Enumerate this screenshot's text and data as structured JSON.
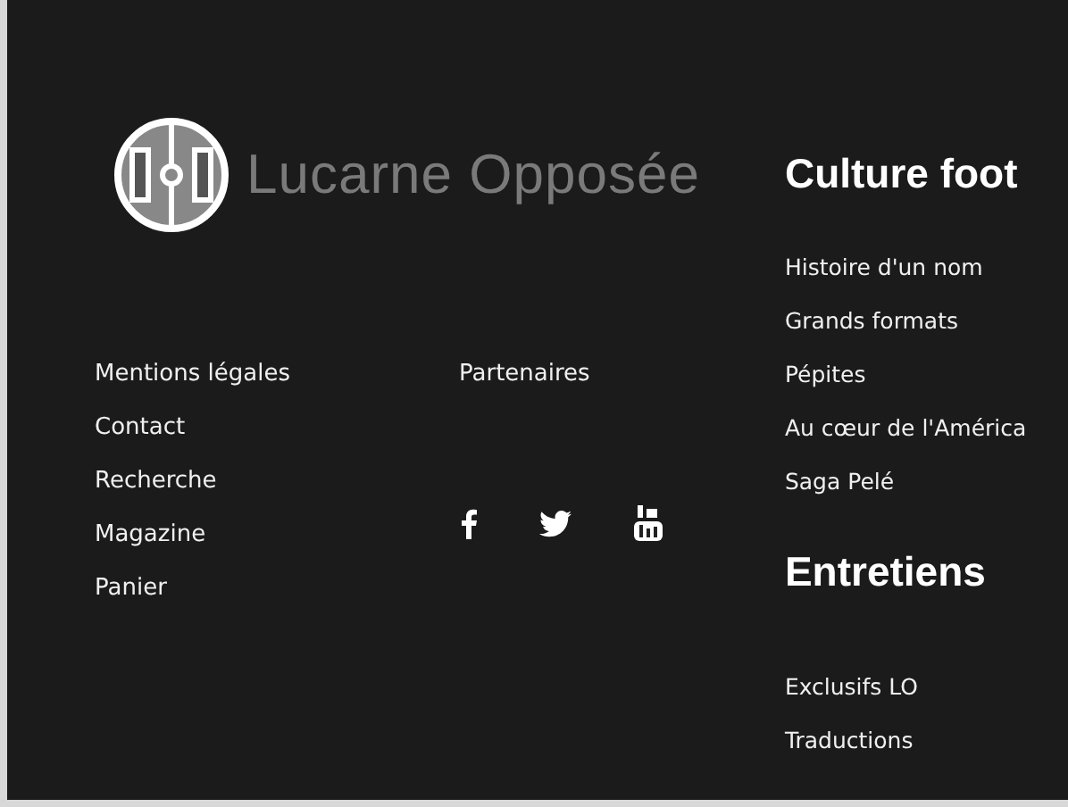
{
  "logo": {
    "text": "Lucarne Opposée"
  },
  "links_left": [
    "Mentions légales",
    "Contact",
    "Recherche",
    "Magazine",
    "Panier"
  ],
  "links_middle": [
    "Partenaires"
  ],
  "social": [
    {
      "kind": "facebook"
    },
    {
      "kind": "twitter"
    },
    {
      "kind": "youtube"
    }
  ],
  "sections": [
    {
      "heading": "Culture foot",
      "links": [
        "Histoire d'un nom",
        "Grands formats",
        "Pépites",
        "Au cœur de l'América",
        "Saga Pelé"
      ]
    },
    {
      "heading": "Entretiens",
      "links": [
        "Exclusifs LO",
        "Traductions"
      ]
    }
  ]
}
